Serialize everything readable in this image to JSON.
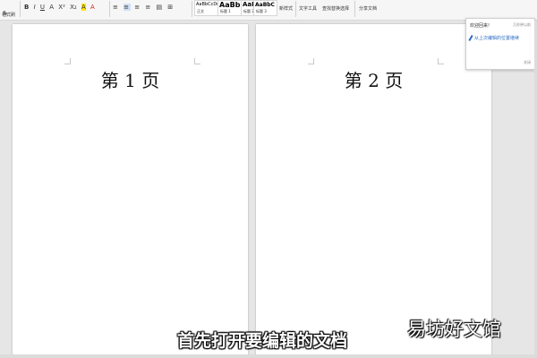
{
  "ribbon": {
    "format_painter_label": "格式刷",
    "font_tools": [
      "B",
      "I",
      "U",
      "A",
      "X²",
      "X₂",
      "A",
      "A"
    ],
    "paragraph_tools": [
      "≡",
      "≡",
      "≡",
      "≡",
      "▤",
      "⊞"
    ],
    "styles": [
      {
        "preview": "AaBbCcDd",
        "name": "正文"
      },
      {
        "preview": "AaBb",
        "name": "标题 1"
      },
      {
        "preview": "AaBbC",
        "name": "标题 2"
      },
      {
        "preview": "AaBbC",
        "name": "标题 3"
      }
    ],
    "new_style_label": "新样式",
    "text_tools_label": "文字工具",
    "find_replace_label": "查找替换",
    "select_label": "选择",
    "share_doc_label": "分享文档"
  },
  "pages": [
    {
      "title": "第 1 页"
    },
    {
      "title": "第 2 页"
    }
  ],
  "welcome_panel": {
    "title": "欢迎回来!",
    "right_hint": "几秒钟以前",
    "link_text": "从上次编辑的位置继续",
    "close_label": "关闭"
  },
  "subtitle": "首先打开要编辑的文档",
  "watermark": "易坊好文馆"
}
